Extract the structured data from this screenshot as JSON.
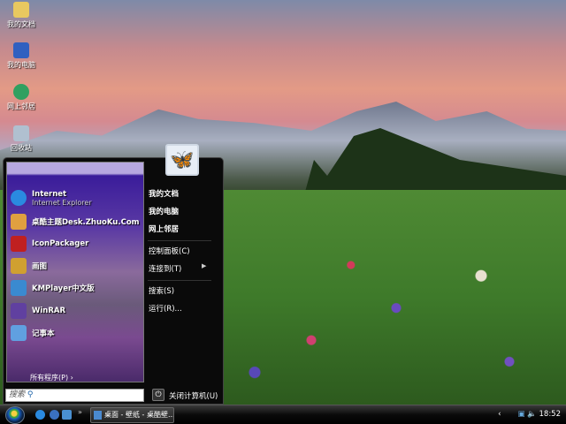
{
  "desktop": {
    "icons": [
      {
        "label": "我的文档",
        "icon": "folder-icon"
      },
      {
        "label": "我的电脑",
        "icon": "computer-icon"
      },
      {
        "label": "网上邻居",
        "icon": "network-icon"
      },
      {
        "label": "回收站",
        "icon": "recycle-bin-icon"
      }
    ]
  },
  "start_menu": {
    "programs": [
      {
        "label": "Internet",
        "sub": "Internet Explorer",
        "icon": "ie-icon",
        "color": "#2a8ae0"
      },
      {
        "label": "桌酷主题Desk.ZhuoKu.Com",
        "icon": "zhuoku-icon",
        "color": "#e0a040"
      },
      {
        "label": "IconPackager",
        "icon": "iconpackager-icon",
        "color": "#c02020"
      },
      {
        "label": "画图",
        "icon": "paint-icon",
        "color": "#d0a030"
      },
      {
        "label": "KMPlayer中文版",
        "icon": "kmplayer-icon",
        "color": "#3a8ad0"
      },
      {
        "label": "WinRAR",
        "icon": "winrar-icon",
        "color": "#6040a0"
      },
      {
        "label": "记事本",
        "icon": "notepad-icon",
        "color": "#60a0e0"
      }
    ],
    "all_programs": "所有程序(P)",
    "places": [
      "我的文档",
      "我的电脑",
      "网上邻居"
    ],
    "system": [
      "控制面板(C)",
      "连接到(T)"
    ],
    "tools": [
      "搜索(S)",
      "运行(R)..."
    ],
    "search_placeholder": "搜索",
    "shutdown": "关闭计算机(U)"
  },
  "taskbar": {
    "task_label": "桌面 - 壁纸 - 桌酷壁...",
    "chevron": "»",
    "clock": "18:52",
    "tray_arrow": "‹"
  }
}
